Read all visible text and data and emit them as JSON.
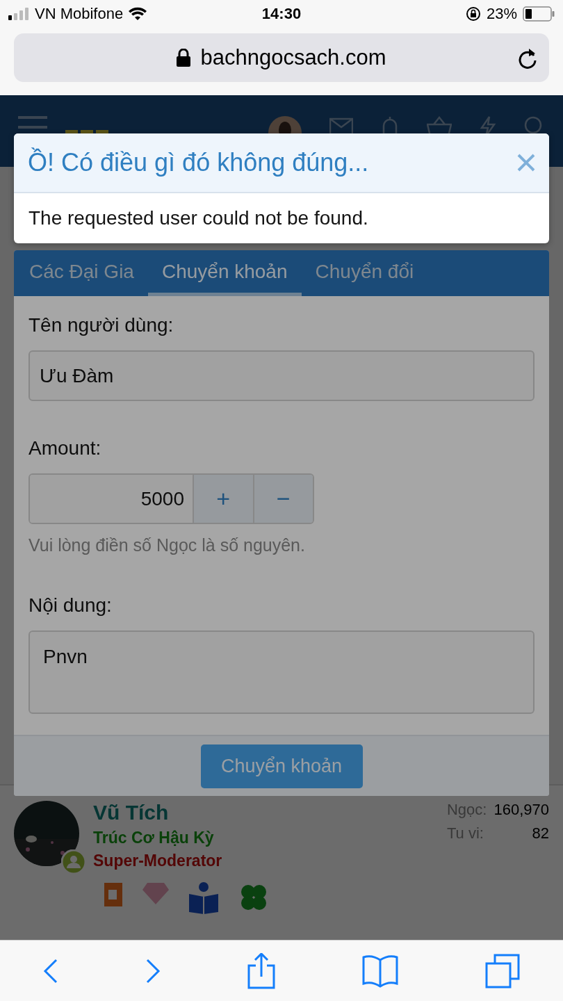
{
  "status_bar": {
    "carrier": "VN Mobifone",
    "time": "14:30",
    "battery": "23%"
  },
  "browser": {
    "url": "bachngocsach.com"
  },
  "site_header": {
    "kind": "logo_covered"
  },
  "alert": {
    "title": "Ồ! Có điều gì đó không đúng...",
    "message": "The requested user could not be found."
  },
  "modal": {
    "tabs": [
      {
        "label": "Các Đại Gia",
        "selected": false
      },
      {
        "label": "Chuyển khoản",
        "selected": true
      },
      {
        "label": "Chuyển đổi",
        "selected": false
      }
    ],
    "fields": [
      {
        "kind": "text",
        "label": "Tên người dùng:",
        "value": "Ưu Đàm"
      },
      {
        "kind": "number",
        "label": "Amount:",
        "value": "5000",
        "increment": "+",
        "decrement": "−",
        "hint": "Vui lòng điền số Ngọc là số nguyên."
      },
      {
        "kind": "textarea",
        "label": "Nội dung:",
        "value": "Pnvn"
      }
    ],
    "submit": "Chuyển khoản"
  },
  "member": {
    "name": "Vũ Tích",
    "rank": "Trúc Cơ Hậu Kỳ",
    "role": "Super-Moderator",
    "stats": [
      {
        "label": "Ngọc:",
        "value": "160,970"
      },
      {
        "label": "Tu vi:",
        "value": "82"
      }
    ]
  }
}
